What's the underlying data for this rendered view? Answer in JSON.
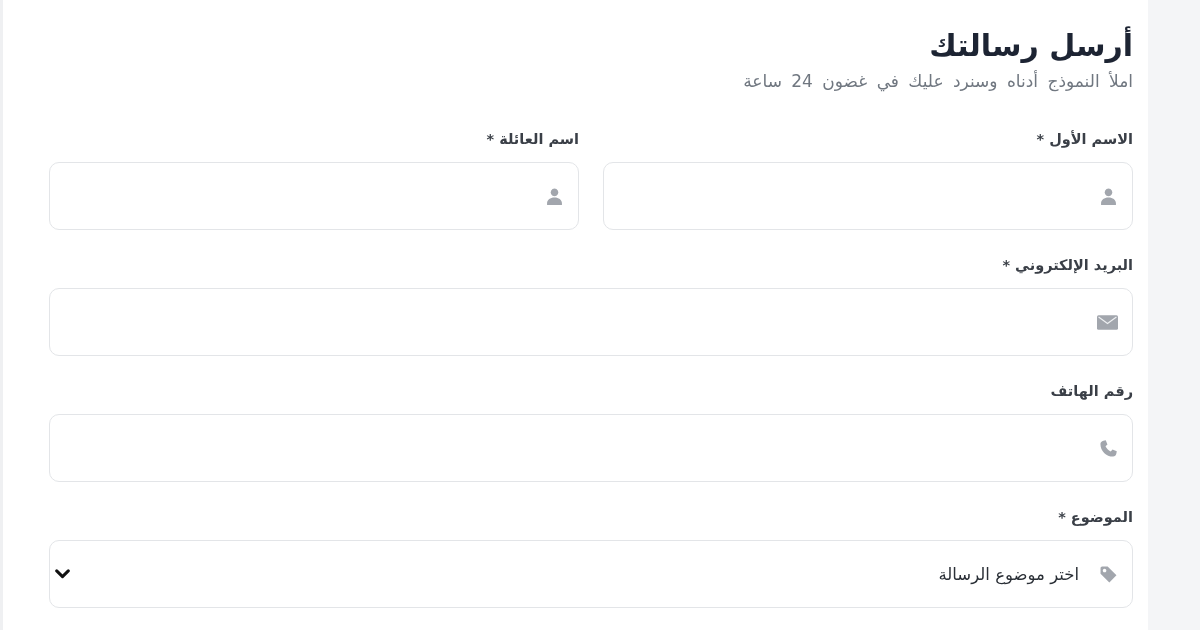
{
  "form": {
    "title": "أرسل رسالتك",
    "subtitle": "املأ النموذج أدناه وسنرد عليك في غضون 24 ساعة",
    "rows": [
      {
        "fields": [
          {
            "kind": "name",
            "label": "الاسم الأول *"
          },
          {
            "kind": "name",
            "label": "اسم العائلة *"
          }
        ]
      },
      {
        "fields": [
          {
            "kind": "email",
            "label": "البريد الإلكتروني *"
          }
        ]
      },
      {
        "fields": [
          {
            "kind": "phone",
            "label": "رقم الهاتف"
          }
        ]
      },
      {
        "fields": [
          {
            "kind": "select",
            "label": "الموضوع *",
            "value": "اختر موضوع الرسالة"
          }
        ]
      }
    ]
  }
}
